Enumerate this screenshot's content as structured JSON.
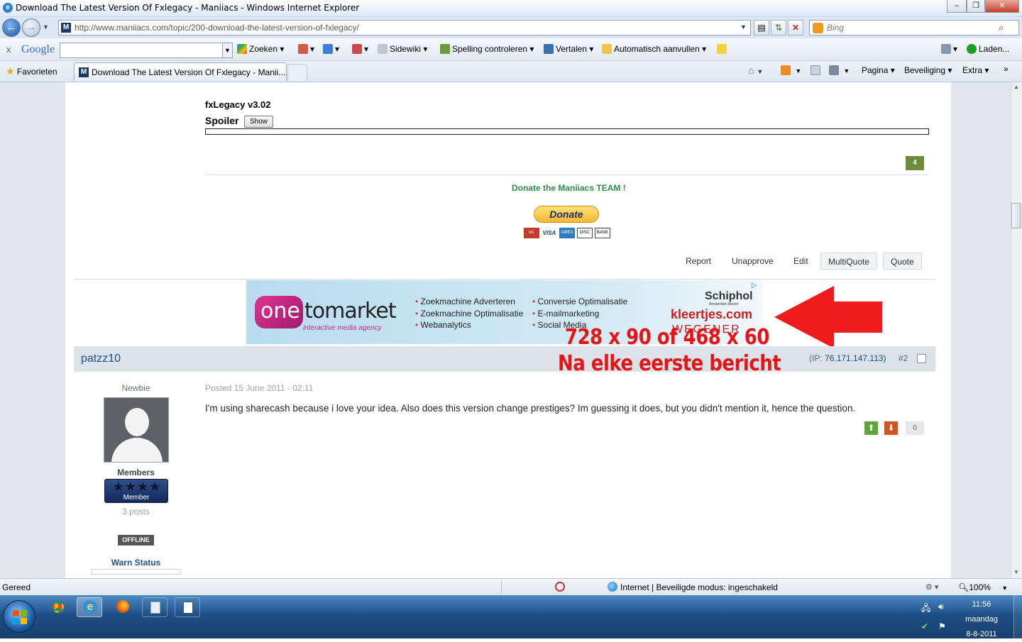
{
  "window": {
    "title": "Download The Latest Version Of Fxlegacy - Maniiacs - Windows Internet Explorer",
    "minimize": "‒",
    "maximize": "❐",
    "close": "✕"
  },
  "address_bar": {
    "url": "http://www.maniiacs.com/topic/200-download-the-latest-version-of-fxlegacy/",
    "favicon": "M",
    "search_placeholder": "Bing"
  },
  "google_toolbar": {
    "close": "x",
    "logo": "Google",
    "zoeken": "Zoeken",
    "sidewiki": "Sidewiki",
    "spelling": "Spelling controleren",
    "vertalen": "Vertalen",
    "autofill": "Automatisch aanvullen",
    "laden": "Laden..."
  },
  "favorites_bar": {
    "favorieten": "Favorieten",
    "tab_title": "Download The Latest Version Of Fxlegacy - Manii...",
    "pagina": "Pagina",
    "beveiliging": "Beveiliging",
    "extra": "Extra"
  },
  "post1": {
    "title": "fxLegacy v3.02",
    "spoiler_label": "Spoiler",
    "spoiler_button": "Show",
    "reputation": "4",
    "donate_text": "Donate the Maniiacs TEAM !",
    "donate_button": "Donate",
    "cards": [
      "MC",
      "VISA",
      "AMEX",
      "DISC",
      "BANK"
    ],
    "actions": [
      "Report",
      "Unapprove",
      "Edit",
      "MultiQuote",
      "Quote"
    ]
  },
  "ad": {
    "brand_one": "one",
    "brand_rest": "tomarket",
    "tagline": "interactive media agency",
    "services_left": [
      "Zoekmachine Adverteren",
      "Zoekmachine Optimalisatie",
      "Webanalytics"
    ],
    "services_right": [
      "Conversie Optimalisatie",
      "E-mailmarketing",
      "Social Media"
    ],
    "client1": "Schiphol",
    "client1_sub": "Amsterdam Airport",
    "client2": "kleertjes.com",
    "client3": "WEGENER",
    "overlay_line1": "728 x 90 of 468 x 60",
    "overlay_line2": "Na elke eerste bericht"
  },
  "post2": {
    "author": "patzz10",
    "ip_label": "(IP:",
    "ip": "76.171.147.113)",
    "post_number": "#2",
    "rank_title": "Newbie",
    "group": "Members",
    "badge": "Member",
    "posts": "3 posts",
    "status": "OFFLINE",
    "warn": "Warn Status",
    "posted": "Posted 15 June 2011 - 02:11",
    "body": "I'm using sharecash because i love your idea. Also does this version change prestiges? Im guessing it does, but you didn't mention it, hence the question.",
    "reputation": "0"
  },
  "status_bar": {
    "left": "Gereed",
    "zone": "Internet | Beveiligde modus: ingeschakeld",
    "zoom": "100%"
  },
  "taskbar": {
    "time": "11:56",
    "day": "maandag",
    "date": "8-8-2011"
  }
}
